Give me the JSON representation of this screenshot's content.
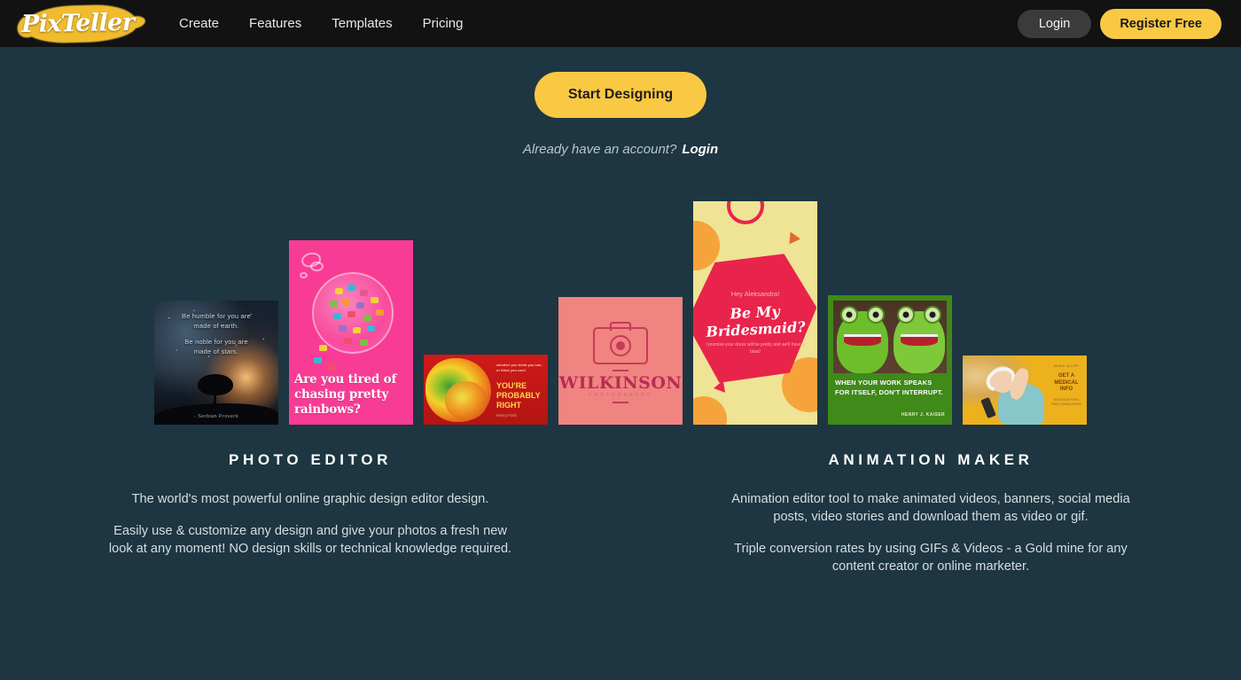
{
  "header": {
    "logo_text": "PixTeller",
    "nav": [
      {
        "label": "Create"
      },
      {
        "label": "Features"
      },
      {
        "label": "Templates"
      },
      {
        "label": "Pricing"
      }
    ],
    "login_label": "Login",
    "register_label": "Register Free"
  },
  "hero": {
    "cta_label": "Start Designing",
    "account_prompt": "Already have an account?",
    "login_link": "Login"
  },
  "gallery": {
    "items": [
      {
        "name": "humble-stars-quote",
        "quote_line1": "Be humble for you are",
        "quote_line2": "made of earth.",
        "quote_line3": "Be noble for you are",
        "quote_line4": "made of stars.",
        "attribution": "- Serbian Proverb"
      },
      {
        "name": "candy-rainbows",
        "text": "Are you tired of chasing pretty rainbows?"
      },
      {
        "name": "henry-ford-fish",
        "pretext": "whether you think you can, or think you can't",
        "headline": "YOU'RE PROBABLY RIGHT",
        "attribution": "Henry Ford"
      },
      {
        "name": "wilkinson-camera-logo",
        "brand": "WILKINSON",
        "subtitle": "PHOTOGRAPHY"
      },
      {
        "name": "be-my-bridesmaid",
        "greeting": "Hey Aleksandra!",
        "headline": "Be My Bridesmaid?",
        "note": "I promise your dress will be pretty and we'll have a blast!"
      },
      {
        "name": "kermit-work-speaks",
        "quote": "WHEN YOUR WORK SPEAKS FOR ITSELF, DON'T INTERRUPT.",
        "attribution": "HENRY J. KAISER"
      },
      {
        "name": "music-headphones-ad",
        "eyebrow": "MUSIC IS LIFE",
        "headline": "GET A MEDICAL INFO",
        "sub": "BOOK NOW FOR A FREE CONSULTATION"
      }
    ]
  },
  "features": [
    {
      "title": "PHOTO EDITOR",
      "paragraph1": "The world's most powerful online graphic design editor design.",
      "paragraph2": "Easily use & customize any design and give your photos a fresh new look at any moment! NO design skills or technical knowledge required."
    },
    {
      "title": "ANIMATION MAKER",
      "paragraph1": "Animation editor tool to make animated videos, banners, social media posts, video stories and download them as video or gif.",
      "paragraph2": "Triple conversion rates by using GIFs & Videos - a Gold mine for any content creator or online marketer."
    }
  ],
  "colors": {
    "page_background": "#1d3641",
    "header_background": "#121212",
    "accent_yellow": "#fac943",
    "login_button": "#3b3b3b",
    "text_light": "#d6dde1"
  }
}
